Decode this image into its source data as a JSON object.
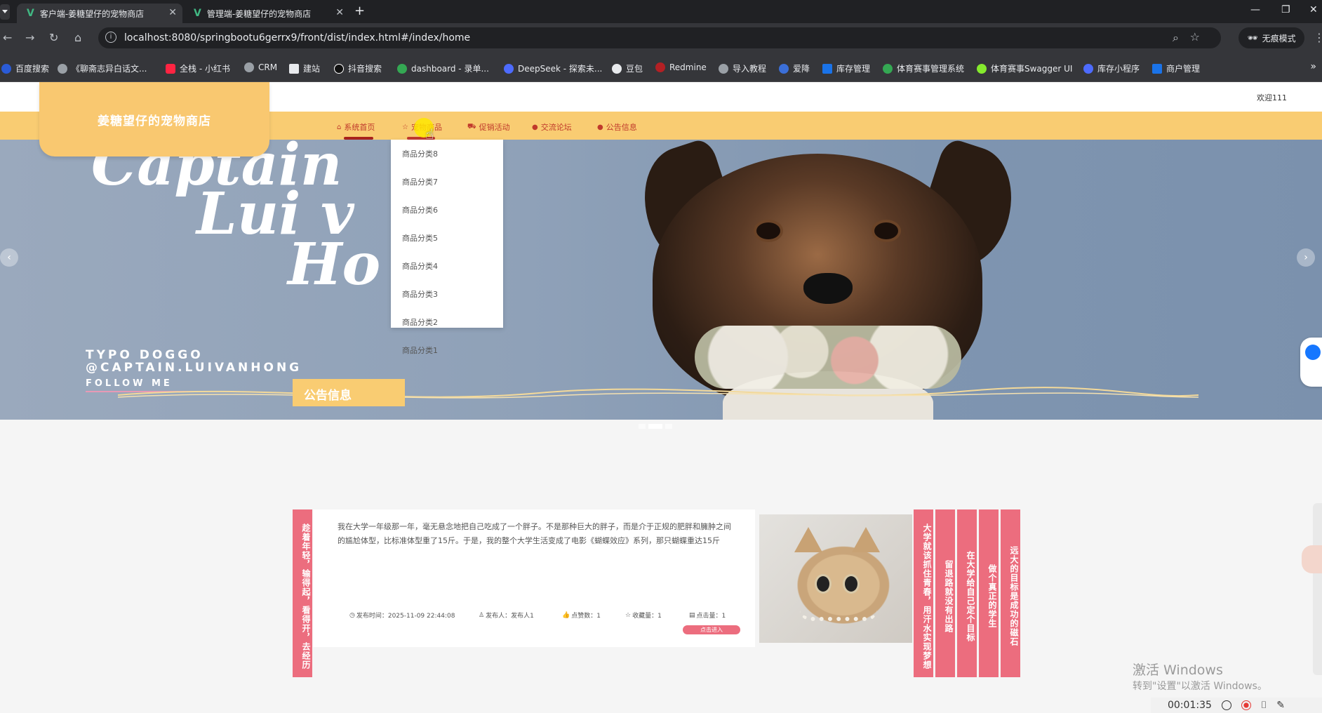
{
  "browser": {
    "tabs": [
      {
        "title": "客户端-姜糖望仔的宠物商店",
        "active": true
      },
      {
        "title": "管理端-姜糖望仔的宠物商店",
        "active": false
      }
    ],
    "url": "localhost:8080/springbootu6gerrx9/front/dist/index.html#/index/home",
    "incognito_label": "无痕模式",
    "bookmarks": [
      "百度搜索",
      "《聊斋志异白话文...",
      "全栈 - 小红书",
      "CRM",
      "建站",
      "抖音搜索",
      "dashboard - 录单...",
      "DeepSeek - 探索未...",
      "豆包",
      "Redmine",
      "导入教程",
      "爱降",
      "库存管理",
      "体育赛事管理系统",
      "体育赛事Swagger UI",
      "库存小程序",
      "商户管理"
    ]
  },
  "site": {
    "logo_text": "姜糖望仔的宠物商店",
    "welcome": "欢迎111",
    "menu": [
      {
        "label": "系统首页",
        "icon": "home-icon",
        "active": true
      },
      {
        "label": "宠物商品",
        "icon": "star-icon",
        "active": false,
        "hovered": true
      },
      {
        "label": "促销活动",
        "icon": "bag-icon",
        "active": false
      },
      {
        "label": "交流论坛",
        "icon": "dot-icon",
        "active": false
      },
      {
        "label": "公告信息",
        "icon": "dot-icon",
        "active": false
      }
    ],
    "dropdown": [
      "商品分类8",
      "商品分类7",
      "商品分类6",
      "商品分类5",
      "商品分类4",
      "商品分类3",
      "商品分类2",
      "商品分类1"
    ],
    "banner": {
      "script_lines": [
        "Captain",
        "Lui v",
        "Ho"
      ],
      "caps_lines": [
        "TYPO DOGGO",
        "@CAPTAIN.LUIVANHONG",
        "FOLLOW ME"
      ],
      "slides": 3,
      "active_slide": 2
    }
  },
  "notice": {
    "section_title": "公告信息",
    "left_slogan": "趁着年轻，输得起，看得开，去经历",
    "body": "我在大学一年级那一年，毫无悬念地把自己吃成了一个胖子。不是那种巨大的胖子，而是介于正规的肥胖和臃肿之间的尴尬体型，比标准体型重了15斤。于是，我的整个大学生活变成了电影《蝴蝶效应》系列，那只蝴蝶重达15斤",
    "meta": {
      "time": "发布时间：2025-11-09 22:44:08",
      "publisher": "发布人：发布人1",
      "likes": "点赞数：1",
      "favorites": "收藏量：1",
      "clicks": "点击量：1"
    },
    "enter_button": "点击进入",
    "right_slogans": [
      "大学就该抓住青春，用汗水实现梦想",
      "留退路就没有出路",
      "在大学给自己定个目标",
      "做个真正的学生",
      "远大的目标是成功的磁石"
    ]
  },
  "overlay": {
    "windows_activate": "激活 Windows",
    "windows_activate_sub": "转到\"设置\"以激活 Windows。",
    "record_time": "00:01:35"
  }
}
